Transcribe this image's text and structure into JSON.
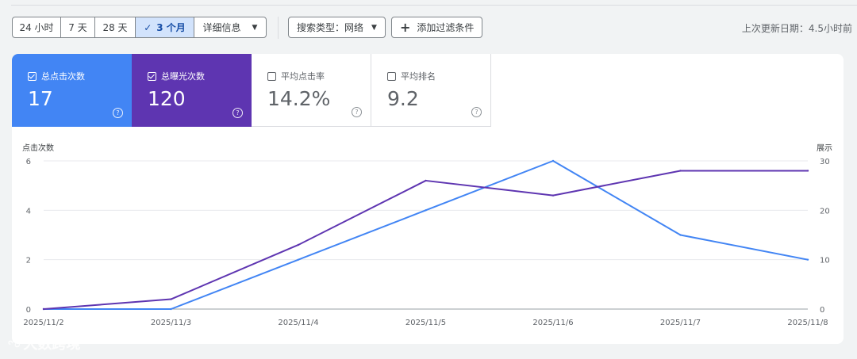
{
  "toolbar": {
    "ranges": [
      {
        "label": "24 小时",
        "active": false
      },
      {
        "label": "7 天",
        "active": false
      },
      {
        "label": "28 天",
        "active": false
      },
      {
        "label": "3 个月",
        "active": true
      },
      {
        "label": "详细信息",
        "active": false
      }
    ],
    "search_type_label": "搜索类型：网络",
    "add_filter_label": "添加过滤条件",
    "last_updated": "上次更新日期：4.5小时前"
  },
  "metrics": [
    {
      "label": "总点击次数",
      "value": "17",
      "checked": true,
      "color": "#4285f4"
    },
    {
      "label": "总曝光次数",
      "value": "120",
      "checked": true,
      "color": "#5e35b1"
    },
    {
      "label": "平均点击率",
      "value": "14.2%",
      "checked": false
    },
    {
      "label": "平均排名",
      "value": "9.2",
      "checked": false
    }
  ],
  "chart_data": {
    "type": "line",
    "ylabel": "点击次数",
    "y2label": "展示",
    "x": [
      "2025/11/2",
      "2025/11/3",
      "2025/11/4",
      "2025/11/5",
      "2025/11/6",
      "2025/11/7",
      "2025/11/8"
    ],
    "ylim": [
      0,
      6
    ],
    "y_ticks": [
      "0",
      "2",
      "4",
      "6"
    ],
    "y2lim": [
      0,
      30
    ],
    "y2_ticks": [
      "0",
      "10",
      "20",
      "30"
    ],
    "series": [
      {
        "name": "总点击次数",
        "axis": "left",
        "color": "#4285f4",
        "values": [
          0,
          0,
          2,
          4,
          6,
          3,
          2
        ]
      },
      {
        "name": "总曝光次数",
        "axis": "right",
        "color": "#5e35b1",
        "values": [
          0,
          2,
          13,
          26,
          23,
          28,
          28
        ]
      }
    ]
  },
  "watermark": {
    "text": "大数跨境",
    "logo": "ಌ"
  }
}
